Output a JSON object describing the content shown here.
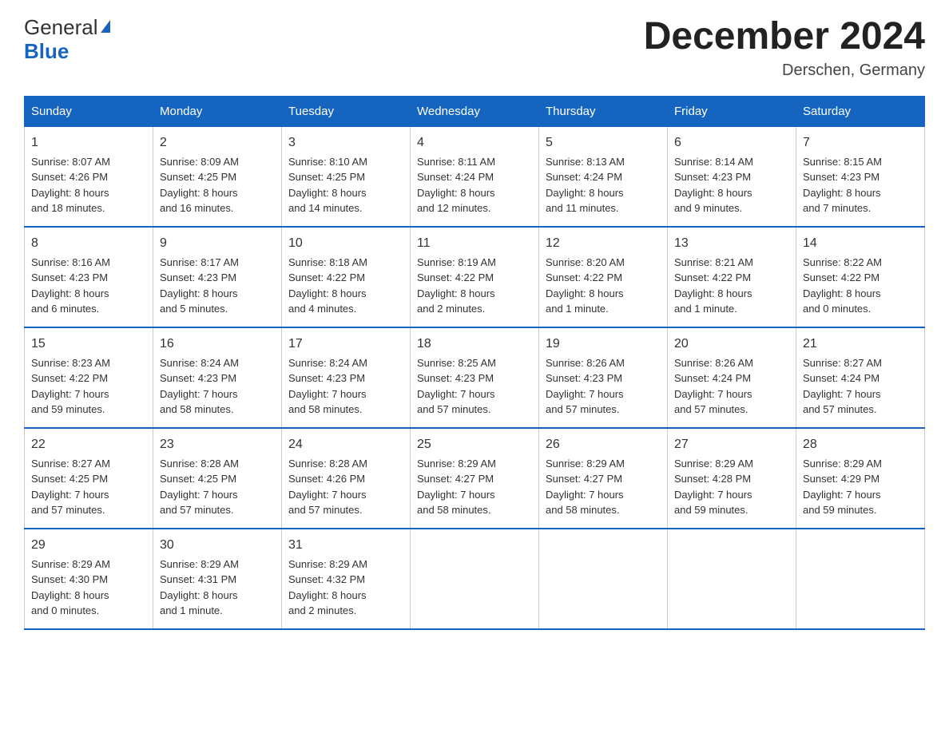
{
  "logo": {
    "general": "General",
    "blue": "Blue"
  },
  "title": "December 2024",
  "subtitle": "Derschen, Germany",
  "days_of_week": [
    "Sunday",
    "Monday",
    "Tuesday",
    "Wednesday",
    "Thursday",
    "Friday",
    "Saturday"
  ],
  "weeks": [
    [
      {
        "day": "1",
        "info": "Sunrise: 8:07 AM\nSunset: 4:26 PM\nDaylight: 8 hours\nand 18 minutes."
      },
      {
        "day": "2",
        "info": "Sunrise: 8:09 AM\nSunset: 4:25 PM\nDaylight: 8 hours\nand 16 minutes."
      },
      {
        "day": "3",
        "info": "Sunrise: 8:10 AM\nSunset: 4:25 PM\nDaylight: 8 hours\nand 14 minutes."
      },
      {
        "day": "4",
        "info": "Sunrise: 8:11 AM\nSunset: 4:24 PM\nDaylight: 8 hours\nand 12 minutes."
      },
      {
        "day": "5",
        "info": "Sunrise: 8:13 AM\nSunset: 4:24 PM\nDaylight: 8 hours\nand 11 minutes."
      },
      {
        "day": "6",
        "info": "Sunrise: 8:14 AM\nSunset: 4:23 PM\nDaylight: 8 hours\nand 9 minutes."
      },
      {
        "day": "7",
        "info": "Sunrise: 8:15 AM\nSunset: 4:23 PM\nDaylight: 8 hours\nand 7 minutes."
      }
    ],
    [
      {
        "day": "8",
        "info": "Sunrise: 8:16 AM\nSunset: 4:23 PM\nDaylight: 8 hours\nand 6 minutes."
      },
      {
        "day": "9",
        "info": "Sunrise: 8:17 AM\nSunset: 4:23 PM\nDaylight: 8 hours\nand 5 minutes."
      },
      {
        "day": "10",
        "info": "Sunrise: 8:18 AM\nSunset: 4:22 PM\nDaylight: 8 hours\nand 4 minutes."
      },
      {
        "day": "11",
        "info": "Sunrise: 8:19 AM\nSunset: 4:22 PM\nDaylight: 8 hours\nand 2 minutes."
      },
      {
        "day": "12",
        "info": "Sunrise: 8:20 AM\nSunset: 4:22 PM\nDaylight: 8 hours\nand 1 minute."
      },
      {
        "day": "13",
        "info": "Sunrise: 8:21 AM\nSunset: 4:22 PM\nDaylight: 8 hours\nand 1 minute."
      },
      {
        "day": "14",
        "info": "Sunrise: 8:22 AM\nSunset: 4:22 PM\nDaylight: 8 hours\nand 0 minutes."
      }
    ],
    [
      {
        "day": "15",
        "info": "Sunrise: 8:23 AM\nSunset: 4:22 PM\nDaylight: 7 hours\nand 59 minutes."
      },
      {
        "day": "16",
        "info": "Sunrise: 8:24 AM\nSunset: 4:23 PM\nDaylight: 7 hours\nand 58 minutes."
      },
      {
        "day": "17",
        "info": "Sunrise: 8:24 AM\nSunset: 4:23 PM\nDaylight: 7 hours\nand 58 minutes."
      },
      {
        "day": "18",
        "info": "Sunrise: 8:25 AM\nSunset: 4:23 PM\nDaylight: 7 hours\nand 57 minutes."
      },
      {
        "day": "19",
        "info": "Sunrise: 8:26 AM\nSunset: 4:23 PM\nDaylight: 7 hours\nand 57 minutes."
      },
      {
        "day": "20",
        "info": "Sunrise: 8:26 AM\nSunset: 4:24 PM\nDaylight: 7 hours\nand 57 minutes."
      },
      {
        "day": "21",
        "info": "Sunrise: 8:27 AM\nSunset: 4:24 PM\nDaylight: 7 hours\nand 57 minutes."
      }
    ],
    [
      {
        "day": "22",
        "info": "Sunrise: 8:27 AM\nSunset: 4:25 PM\nDaylight: 7 hours\nand 57 minutes."
      },
      {
        "day": "23",
        "info": "Sunrise: 8:28 AM\nSunset: 4:25 PM\nDaylight: 7 hours\nand 57 minutes."
      },
      {
        "day": "24",
        "info": "Sunrise: 8:28 AM\nSunset: 4:26 PM\nDaylight: 7 hours\nand 57 minutes."
      },
      {
        "day": "25",
        "info": "Sunrise: 8:29 AM\nSunset: 4:27 PM\nDaylight: 7 hours\nand 58 minutes."
      },
      {
        "day": "26",
        "info": "Sunrise: 8:29 AM\nSunset: 4:27 PM\nDaylight: 7 hours\nand 58 minutes."
      },
      {
        "day": "27",
        "info": "Sunrise: 8:29 AM\nSunset: 4:28 PM\nDaylight: 7 hours\nand 59 minutes."
      },
      {
        "day": "28",
        "info": "Sunrise: 8:29 AM\nSunset: 4:29 PM\nDaylight: 7 hours\nand 59 minutes."
      }
    ],
    [
      {
        "day": "29",
        "info": "Sunrise: 8:29 AM\nSunset: 4:30 PM\nDaylight: 8 hours\nand 0 minutes."
      },
      {
        "day": "30",
        "info": "Sunrise: 8:29 AM\nSunset: 4:31 PM\nDaylight: 8 hours\nand 1 minute."
      },
      {
        "day": "31",
        "info": "Sunrise: 8:29 AM\nSunset: 4:32 PM\nDaylight: 8 hours\nand 2 minutes."
      },
      {
        "day": "",
        "info": ""
      },
      {
        "day": "",
        "info": ""
      },
      {
        "day": "",
        "info": ""
      },
      {
        "day": "",
        "info": ""
      }
    ]
  ]
}
